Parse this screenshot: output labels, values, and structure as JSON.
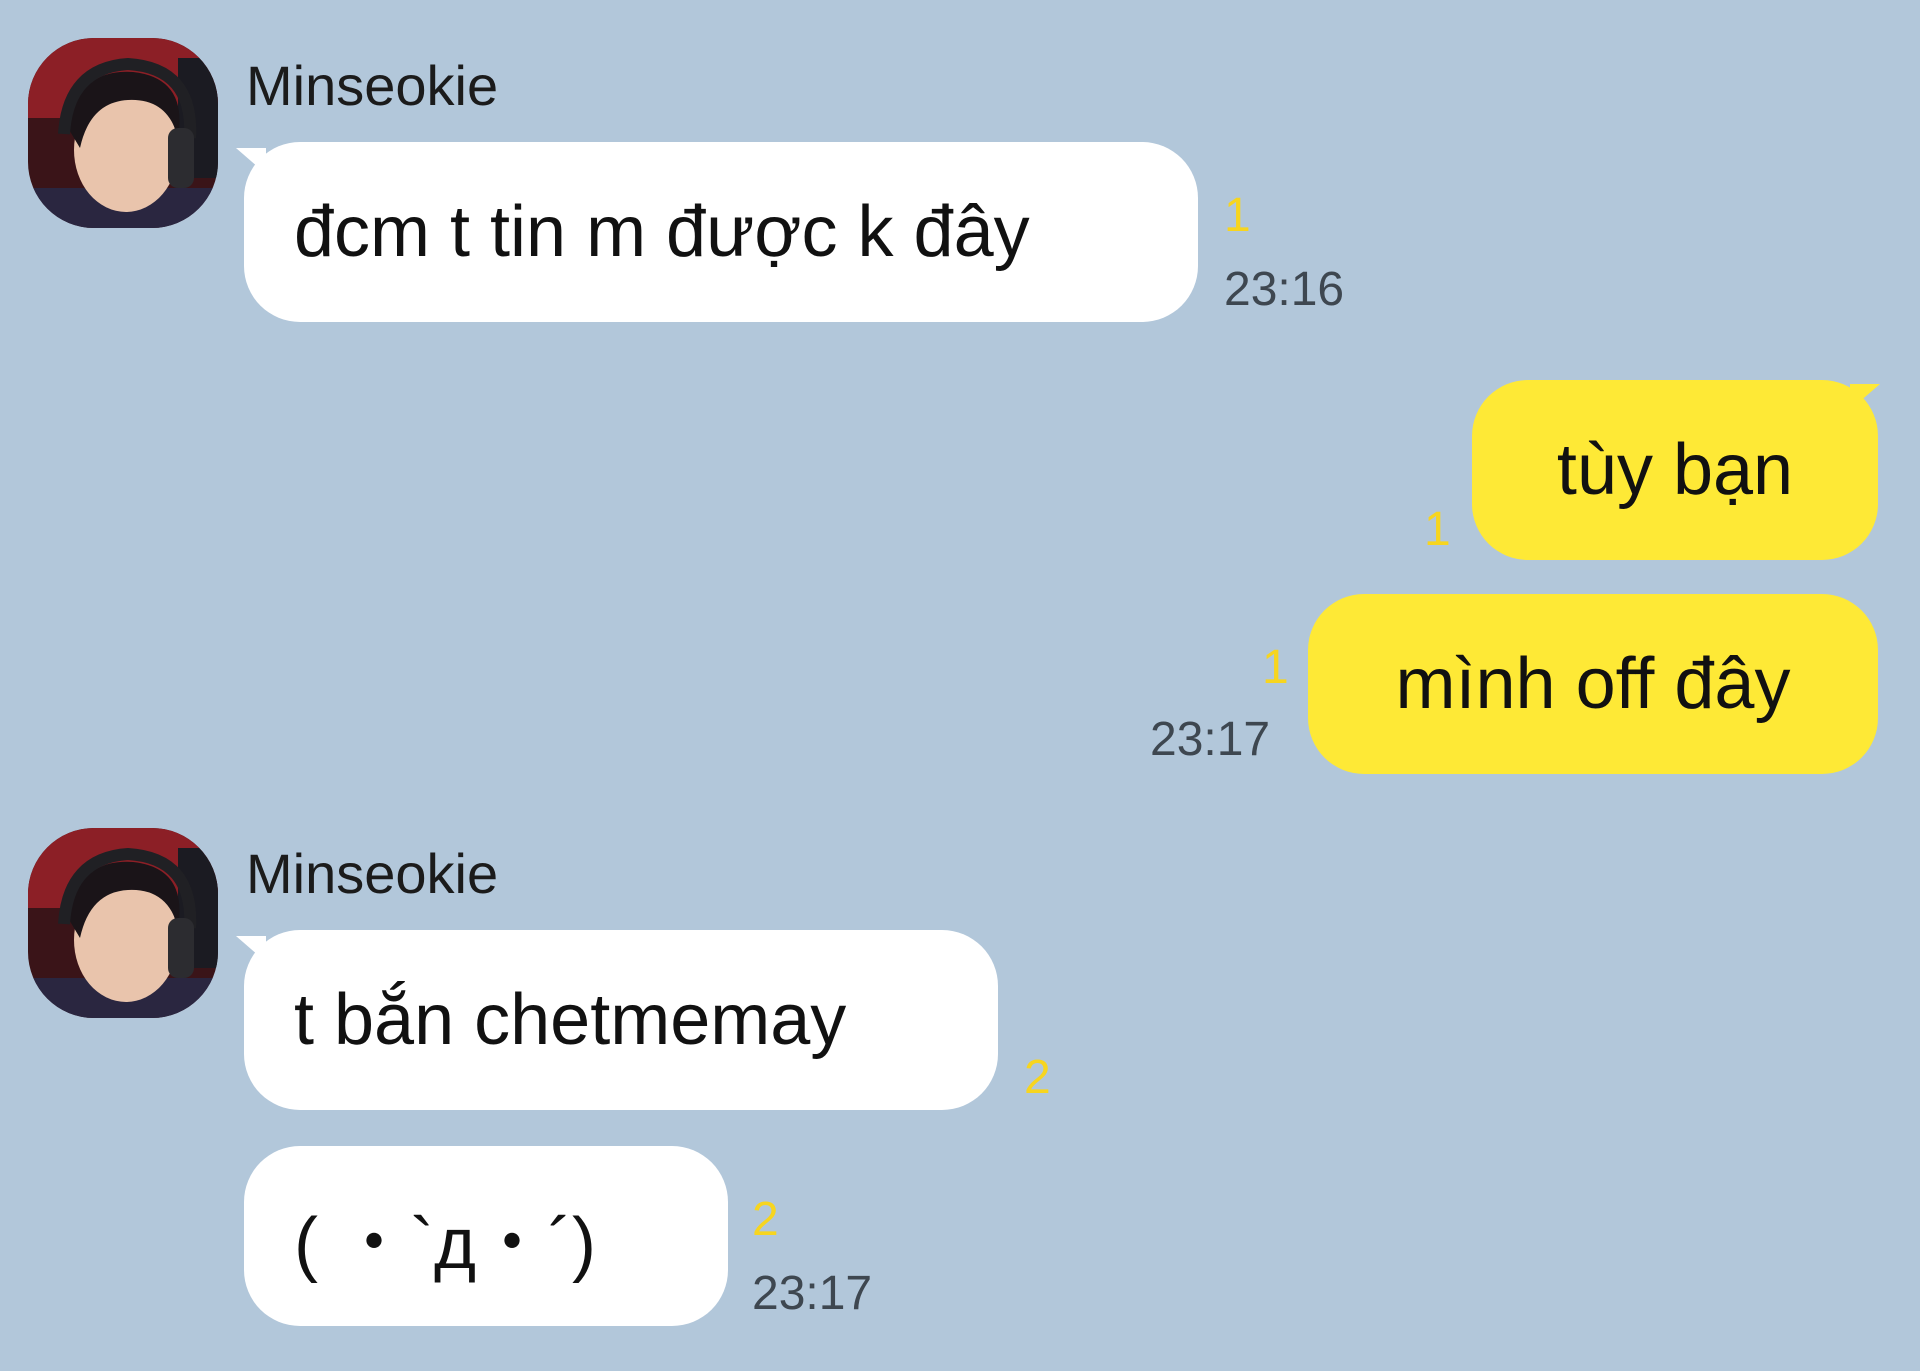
{
  "colors": {
    "background": "#b2c7da",
    "incoming_bubble": "#ffffff",
    "outgoing_bubble": "#fee936",
    "unread_count": "#f7d51f",
    "timestamp": "#3e4750"
  },
  "messages": [
    {
      "sender": "Minseokie",
      "avatar_icon": "profile-photo",
      "items": [
        {
          "text": "đcm t tin m được k đây",
          "unread": "1",
          "time": "23:16"
        }
      ]
    },
    {
      "outgoing": true,
      "items": [
        {
          "text": "tùy bạn",
          "unread": "1"
        },
        {
          "text": "mình off đây",
          "unread": "1",
          "time": "23:17"
        }
      ]
    },
    {
      "sender": "Minseokie",
      "avatar_icon": "profile-photo",
      "items": [
        {
          "text": "t bắn chetmemay",
          "unread": "2"
        },
        {
          "text": "( ・`д・´)",
          "unread": "2",
          "time": "23:17"
        }
      ]
    }
  ]
}
